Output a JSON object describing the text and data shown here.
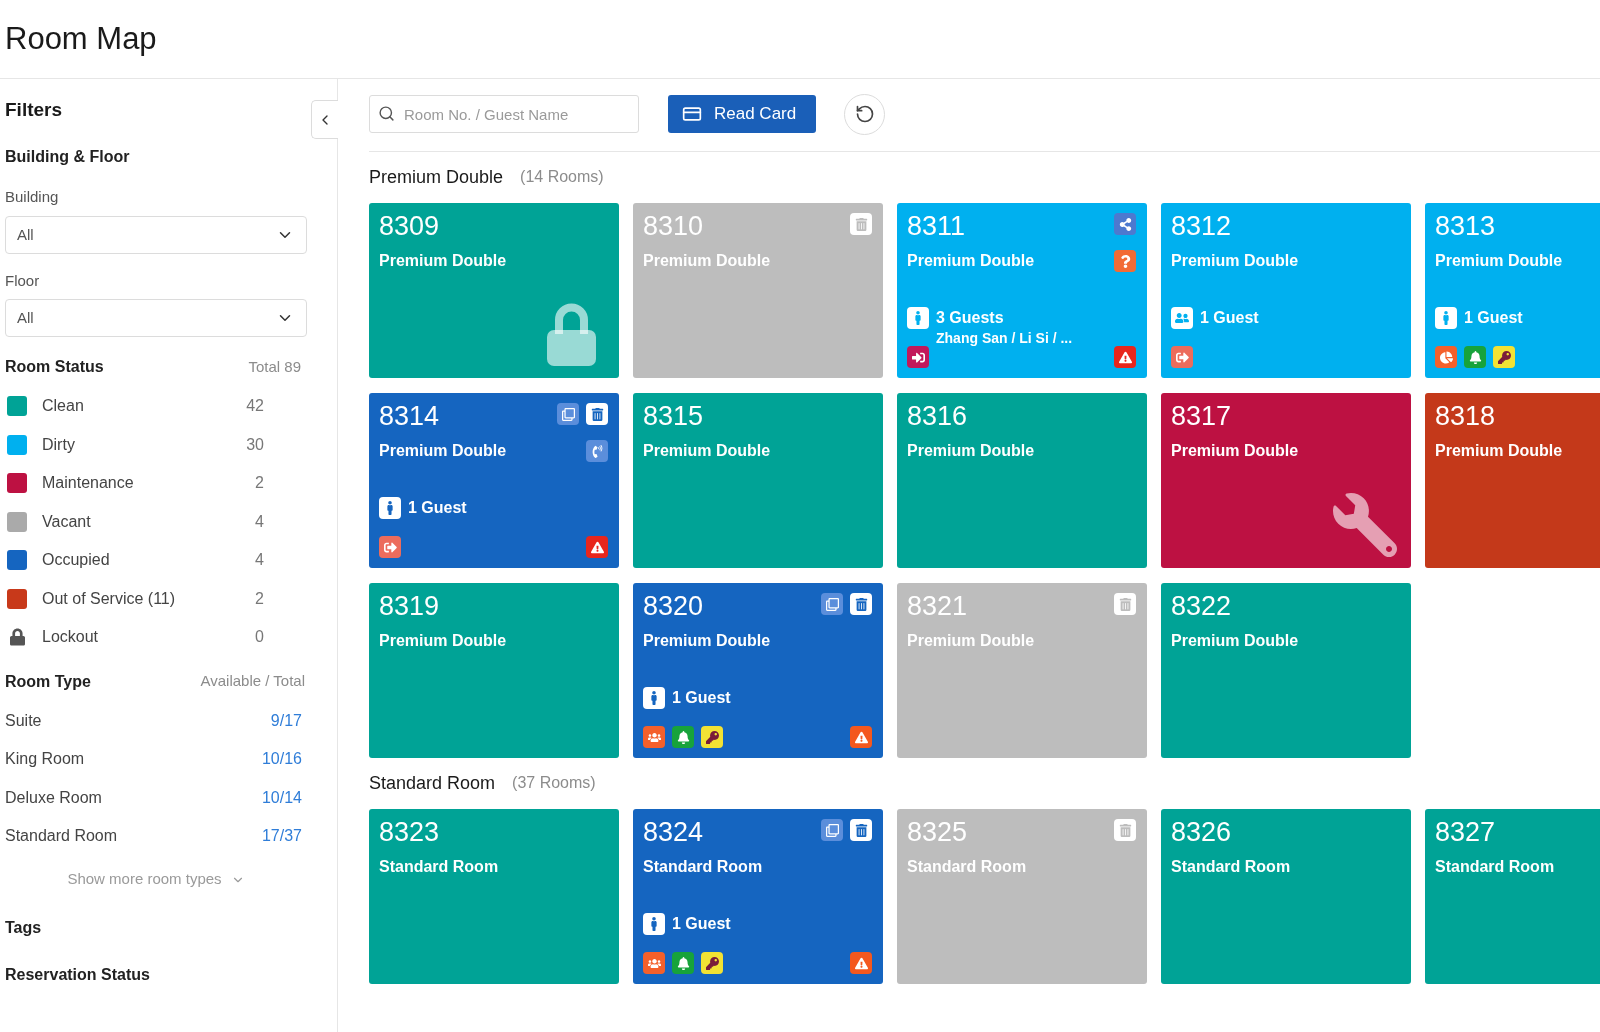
{
  "header": {
    "title": "Room Map"
  },
  "sidebar": {
    "title": "Filters",
    "building_floor": {
      "heading": "Building & Floor",
      "fields": [
        {
          "label": "Building",
          "value": "All"
        },
        {
          "label": "Floor",
          "value": "All"
        }
      ]
    },
    "room_status": {
      "heading": "Room Status",
      "total": "Total 89",
      "items": [
        {
          "kind": "swatch",
          "label": "Clean",
          "count": "42",
          "color": "#00a396"
        },
        {
          "kind": "swatch",
          "label": "Dirty",
          "count": "30",
          "color": "#00b0ef"
        },
        {
          "kind": "swatch",
          "label": "Maintenance",
          "count": "2",
          "color": "#bd1142"
        },
        {
          "kind": "swatch",
          "label": "Vacant",
          "count": "4",
          "color": "#aaaaaa"
        },
        {
          "kind": "swatch",
          "label": "Occupied",
          "count": "4",
          "color": "#1565c0"
        },
        {
          "kind": "swatch",
          "label": "Out of Service (11)",
          "count": "2",
          "color": "#c8391a"
        },
        {
          "kind": "lock",
          "label": "Lockout",
          "count": "0"
        }
      ]
    },
    "room_type": {
      "heading": "Room Type",
      "column_label": "Available / Total",
      "items": [
        {
          "label": "Suite",
          "count": "9/17"
        },
        {
          "label": "King Room",
          "count": "10/16"
        },
        {
          "label": "Deluxe Room",
          "count": "10/14"
        },
        {
          "label": "Standard Room",
          "count": "17/37"
        }
      ],
      "show_more": "Show more room types"
    },
    "sections": [
      {
        "heading": "Tags"
      },
      {
        "heading": "Reservation Status"
      }
    ]
  },
  "toolbar": {
    "search": {
      "placeholder": "Room No. / Guest Name"
    },
    "read_card_button": "Read Card"
  },
  "room_groups": [
    {
      "title": "Premium Double",
      "count": "(14 Rooms)",
      "rooms": [
        {
          "number": "8309",
          "type": "Premium Double",
          "color": "#00a396",
          "watermark": {
            "kind": "lock"
          }
        },
        {
          "number": "8310",
          "type": "Premium Double",
          "color": "#bdbdbd",
          "corner_icons": [
            {
              "kind": "trash",
              "color": "#ffffff"
            }
          ]
        },
        {
          "number": "8311",
          "type": "Premium Double",
          "color": "#00b0ef",
          "corner_icons": [
            {
              "kind": "share",
              "color": "#4d79cf"
            }
          ],
          "side_icons": [
            {
              "kind": "question",
              "color": "#f26b35"
            }
          ],
          "guest": {
            "kind": "single",
            "count": "3 Guests",
            "names": "Zhang San / Li Si / ..."
          },
          "bottom_icons": [
            {
              "kind": "signin",
              "color": "#c2185b"
            }
          ],
          "alert": {
            "color": "#e8261c"
          }
        },
        {
          "number": "8312",
          "type": "Premium Double",
          "color": "#00b0ef",
          "guest": {
            "kind": "pair",
            "count": "1 Guest"
          },
          "bottom_icons": [
            {
              "kind": "signout",
              "color": "#ec6c5c"
            }
          ]
        },
        {
          "number": "8313",
          "type": "Premium Double",
          "color": "#00b0ef",
          "guest": {
            "kind": "single",
            "count": "1 Guest"
          },
          "bottom_icons": [
            {
              "kind": "pie",
              "color": "#f4602b"
            },
            {
              "kind": "bell",
              "color": "#17a33b"
            },
            {
              "kind": "key",
              "color": "#f2e234"
            }
          ]
        },
        {
          "number": "8314",
          "type": "Premium Double",
          "color": "#1565c0",
          "corner_icons": [
            {
              "kind": "copy",
              "color": "#5b8edb"
            },
            {
              "kind": "trash",
              "color": "#ffffff"
            }
          ],
          "side_icons": [
            {
              "kind": "phone",
              "color": "#5b8edb"
            }
          ],
          "guest": {
            "kind": "single",
            "count": "1 Guest"
          },
          "bottom_icons": [
            {
              "kind": "signout",
              "color": "#ec6c5c"
            }
          ],
          "alert": {
            "color": "#e8261c"
          }
        },
        {
          "number": "8315",
          "type": "Premium Double",
          "color": "#00a396"
        },
        {
          "number": "8316",
          "type": "Premium Double",
          "color": "#00a396"
        },
        {
          "number": "8317",
          "type": "Premium Double",
          "color": "#bd1142",
          "watermark": {
            "kind": "wrench"
          }
        },
        {
          "number": "8318",
          "type": "Premium Double",
          "color": "#c4391a"
        },
        {
          "number": "8319",
          "type": "Premium Double",
          "color": "#00a396"
        },
        {
          "number": "8320",
          "type": "Premium Double",
          "color": "#1565c0",
          "corner_icons": [
            {
              "kind": "copy",
              "color": "#5b8edb"
            },
            {
              "kind": "trash",
              "color": "#ffffff"
            }
          ],
          "guest": {
            "kind": "single",
            "count": "1 Guest"
          },
          "bottom_icons": [
            {
              "kind": "people",
              "color": "#f4602b"
            },
            {
              "kind": "bell",
              "color": "#17a33b"
            },
            {
              "kind": "key",
              "color": "#f2e234"
            }
          ],
          "alert": {
            "color": "#f4581e"
          }
        },
        {
          "number": "8321",
          "type": "Premium Double",
          "color": "#bdbdbd",
          "corner_icons": [
            {
              "kind": "trash",
              "color": "#ffffff"
            }
          ]
        },
        {
          "number": "8322",
          "type": "Premium Double",
          "color": "#00a396"
        }
      ]
    },
    {
      "title": "Standard Room",
      "count": "(37 Rooms)",
      "rooms": [
        {
          "number": "8323",
          "type": "Standard Room",
          "color": "#00a396"
        },
        {
          "number": "8324",
          "type": "Standard Room",
          "color": "#1565c0",
          "corner_icons": [
            {
              "kind": "copy",
              "color": "#5b8edb"
            },
            {
              "kind": "trash",
              "color": "#ffffff"
            }
          ],
          "guest": {
            "kind": "single",
            "count": "1 Guest"
          },
          "bottom_icons": [
            {
              "kind": "people",
              "color": "#f4602b"
            },
            {
              "kind": "bell",
              "color": "#17a33b"
            },
            {
              "kind": "key",
              "color": "#f2e234"
            }
          ],
          "alert": {
            "color": "#f4581e"
          }
        },
        {
          "number": "8325",
          "type": "Standard Room",
          "color": "#bdbdbd",
          "corner_icons": [
            {
              "kind": "trash",
              "color": "#ffffff"
            }
          ]
        },
        {
          "number": "8326",
          "type": "Standard Room",
          "color": "#00a396"
        },
        {
          "number": "8327",
          "type": "Standard Room",
          "color": "#00a396"
        }
      ]
    }
  ]
}
